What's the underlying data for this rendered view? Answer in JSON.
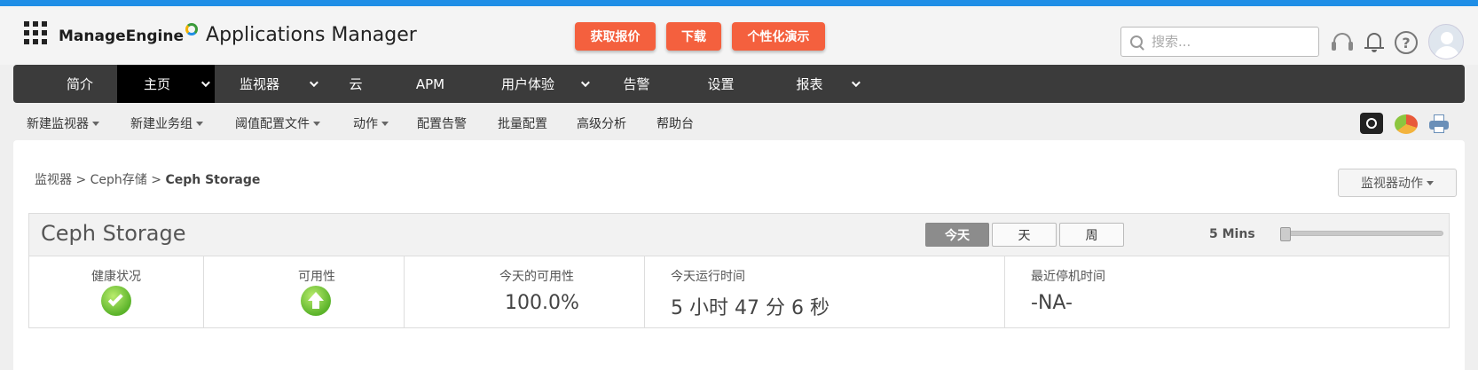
{
  "header": {
    "brand_name": "ManageEngine",
    "app_name": "Applications Manager",
    "cta_buttons": [
      "获取报价",
      "下载",
      "个性化演示"
    ],
    "search_placeholder": "搜索..."
  },
  "nav": {
    "items": [
      "简介",
      "主页",
      "监视器",
      "云",
      "APM",
      "用户体验",
      "告警",
      "设置",
      "报表"
    ],
    "active": "主页"
  },
  "subnav": {
    "items": [
      "新建监视器",
      "新建业务组",
      "阈值配置文件",
      "动作",
      "配置告警",
      "批量配置",
      "高级分析",
      "帮助台"
    ]
  },
  "breadcrumb": {
    "part1": "监视器",
    "separator": " > ",
    "part2": "Ceph存储",
    "current": "Ceph Storage"
  },
  "monitor_actions_label": "监视器动作",
  "panel": {
    "title": "Ceph Storage",
    "periods": [
      "今天",
      "天",
      "周"
    ],
    "active_period": "今天",
    "interval": "5 Mins",
    "slider_level": 0,
    "stats": {
      "health_label": "健康状况",
      "availability_label": "可用性",
      "today_availability_label": "今天的可用性",
      "today_availability_value": "100.0%",
      "uptime_label": "今天运行时间",
      "uptime_value": "5 小时 47 分 6 秒",
      "last_downtime_label": "最近停机时间",
      "last_downtime_value": "-NA-"
    }
  },
  "colors": {
    "top_accent": "#1f8ee6",
    "cta": "#f4603e",
    "nav_bg": "#3b3b3b",
    "nav_active": "#000000",
    "status_ok": "#5bb32a"
  }
}
